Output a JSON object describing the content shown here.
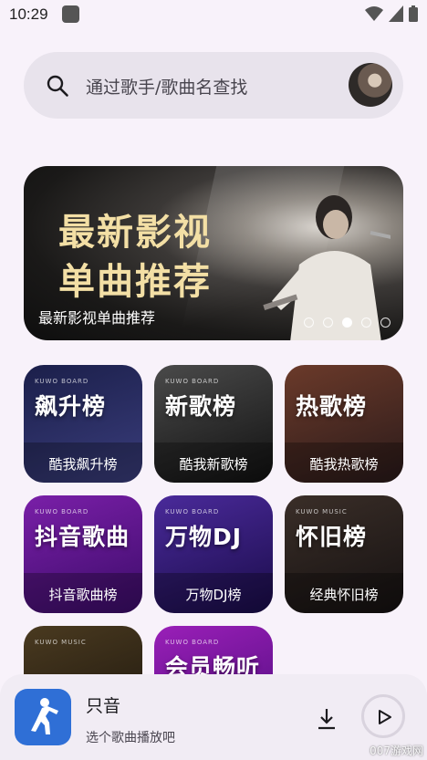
{
  "status_bar": {
    "time": "10:29"
  },
  "search": {
    "placeholder": "通过歌手/歌曲名查找"
  },
  "banner": {
    "headline_line1": "最新影视",
    "headline_line2": "单曲推荐",
    "caption": "最新影视单曲推荐",
    "dot_count": 5,
    "active_dot": 3
  },
  "charts": [
    {
      "title": "飙升榜",
      "label": "酷我飙升榜",
      "brand": "KUWO BOARD",
      "colors": [
        "#1b1f4a",
        "#3a3d7c"
      ]
    },
    {
      "title": "新歌榜",
      "label": "酷我新歌榜",
      "brand": "KUWO BOARD",
      "colors": [
        "#4a4a4a",
        "#111111"
      ]
    },
    {
      "title": "热歌榜",
      "label": "酷我热歌榜",
      "brand": "",
      "colors": [
        "#6b3a2a",
        "#2a1a1a"
      ]
    },
    {
      "title": "抖音歌曲",
      "label": "抖音歌曲榜",
      "brand": "KUWO BOARD",
      "colors": [
        "#7a1fa8",
        "#3c0c6a"
      ]
    },
    {
      "title": "万物DJ",
      "label": "万物DJ榜",
      "brand": "KUWO BOARD",
      "colors": [
        "#4a2a9a",
        "#1a0c4a"
      ]
    },
    {
      "title": "怀旧榜",
      "label": "经典怀旧榜",
      "brand": "KUWO MUSIC",
      "colors": [
        "#3a2e28",
        "#151111"
      ]
    },
    {
      "title": "",
      "label": "",
      "brand": "KUWO MUSIC",
      "colors": [
        "#4a3a20",
        "#1a140c"
      ]
    },
    {
      "title": "会员畅听",
      "label": "",
      "brand": "KUWO BOARD",
      "colors": [
        "#9a1fb8",
        "#4a0c7a"
      ]
    }
  ],
  "player": {
    "title": "只音",
    "subtitle": "选个歌曲播放吧"
  },
  "watermark": "007游戏网"
}
